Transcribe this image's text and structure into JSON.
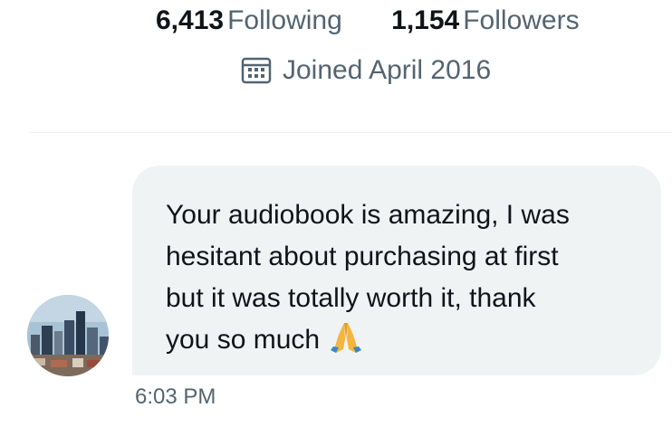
{
  "profile": {
    "following_count": "6,413",
    "following_label": "Following",
    "followers_count": "1,154",
    "followers_label": "Followers",
    "joined": "Joined April 2016"
  },
  "message": {
    "text": "Your audiobook is amazing, I was\nhesitant about purchasing at first\nbut it was totally worth it, thank\nyou so much",
    "emoji": "folded-hands-emoji",
    "timestamp": "6:03 PM"
  },
  "colors": {
    "primary_text": "#0f1419",
    "secondary_text": "#536471",
    "bubble": "#eff3f4",
    "divider": "#eff3f4"
  }
}
